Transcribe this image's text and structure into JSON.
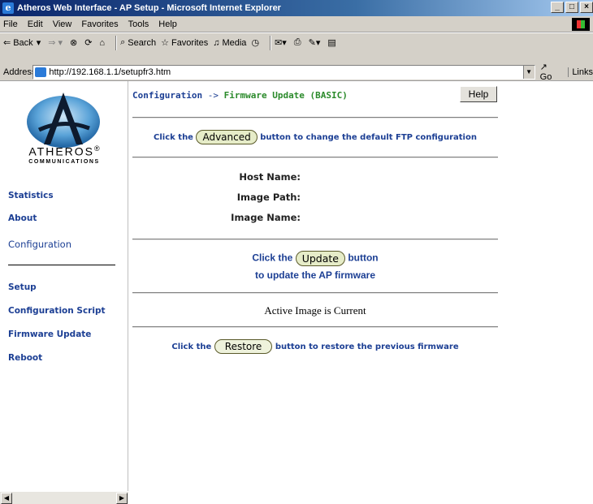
{
  "window": {
    "title": "Atheros Web Interface - AP Setup - Microsoft Internet Explorer",
    "controls": [
      "_",
      "□",
      "×"
    ]
  },
  "menu": [
    "File",
    "Edit",
    "View",
    "Favorites",
    "Tools",
    "Help"
  ],
  "toolbar": {
    "back": "Back",
    "search": "Search",
    "favorites": "Favorites",
    "media": "Media"
  },
  "address": {
    "label": "Address",
    "url": "http://192.168.1.1/setupfr3.htm",
    "go": "Go",
    "links": "Links"
  },
  "sidebar": {
    "brand": "ATHEROS",
    "brand_mark": "®",
    "brand_sub": "COMMUNICATIONS",
    "items": [
      {
        "label": "Statistics"
      },
      {
        "label": "About"
      },
      {
        "label": "Configuration"
      },
      {
        "label": "Setup"
      },
      {
        "label": "Configuration Script"
      },
      {
        "label": "Firmware Update"
      },
      {
        "label": "Reboot"
      }
    ]
  },
  "main": {
    "crumb_section": "Configuration",
    "crumb_arrow": "->",
    "crumb_page": "Firmware Update (BASIC)",
    "help": "Help",
    "advanced_pre": "Click the",
    "advanced_button": "Advanced",
    "advanced_post": "button to change the default FTP configuration",
    "host_name_label": "Host Name:",
    "image_path_label": "Image Path:",
    "image_name_label": "Image Name:",
    "update_pre": "Click the",
    "update_button": "Update",
    "update_post": "button",
    "update_line2": "to update the AP firmware",
    "status": "Active Image is Current",
    "restore_pre": "Click the",
    "restore_button": "Restore",
    "restore_post": "button to restore the previous firmware"
  },
  "colors": {
    "nav": "#1c3f94",
    "crumb_page": "#2a8a2a",
    "titlebar": "#0a246a"
  }
}
